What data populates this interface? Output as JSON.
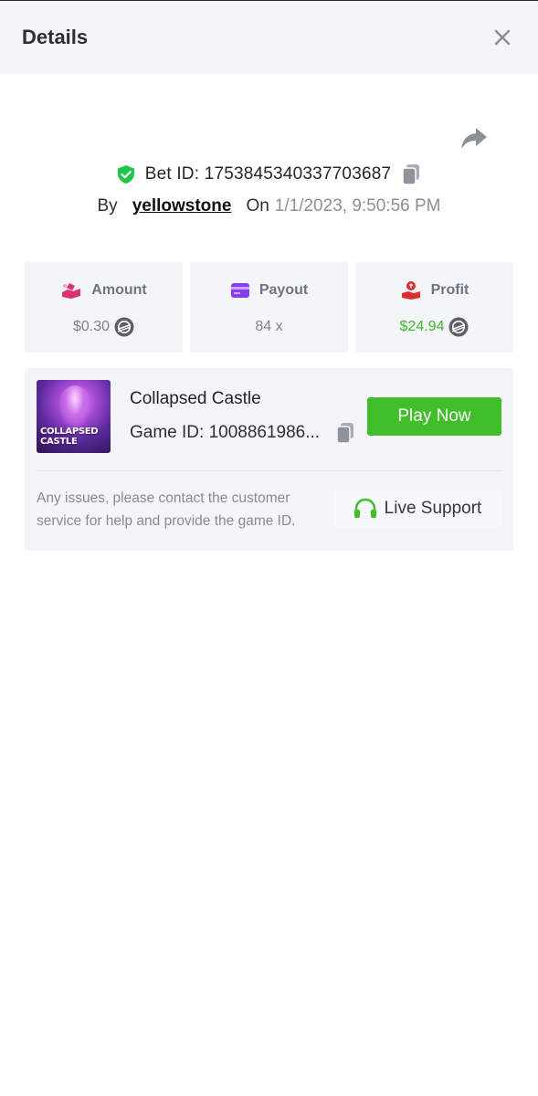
{
  "header": {
    "title": "Details",
    "close_icon": "close-icon"
  },
  "share": {
    "icon": "share-arrow-icon"
  },
  "bet": {
    "id_text": "Bet ID: 1753845340337703687",
    "verified_icon": "shield-check-icon",
    "copy_icon": "copy-icon"
  },
  "meta": {
    "by_label": "By",
    "username": "yellowstone",
    "on_label": "On",
    "datetime": "1/1/2023, 9:50:56 PM"
  },
  "stats": {
    "amount": {
      "label": "Amount",
      "value": "$0.30",
      "icon": "money-hand-icon"
    },
    "payout": {
      "label": "Payout",
      "value": "84 x",
      "icon": "credit-card-icon"
    },
    "profit": {
      "label": "Profit",
      "value": "$24.94",
      "icon": "profit-hand-icon"
    }
  },
  "game": {
    "name": "Collapsed Castle",
    "id_text": "Game ID: 1008861986...",
    "thumb_text_line1": "COLLAPSED",
    "thumb_text_line2": "CASTLE",
    "play_label": "Play Now"
  },
  "support": {
    "note": "Any issues, please contact the customer service for help and provide the game ID.",
    "button_label": "Live Support",
    "icon": "headset-icon"
  },
  "colors": {
    "accent_green": "#41bf2b",
    "profit_green": "#3fb82b",
    "amount_icon": "#e0316a",
    "payout_icon": "#8a3bf0",
    "profit_icon": "#d92f2f",
    "panel_bg": "#f4f5f8"
  }
}
